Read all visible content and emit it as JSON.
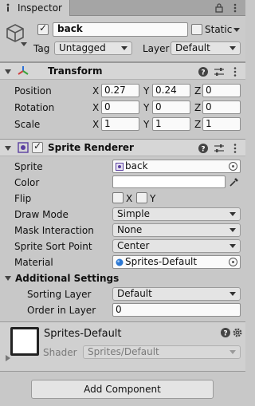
{
  "tab": {
    "label": "Inspector"
  },
  "object": {
    "name": "back",
    "active": true,
    "static_label": "Static",
    "static_checked": false,
    "tag_label": "Tag",
    "tag_value": "Untagged",
    "layer_label": "Layer",
    "layer_value": "Default"
  },
  "transform": {
    "title": "Transform",
    "rows": [
      {
        "label": "Position",
        "x": "0.27",
        "y": "0.24",
        "z": "0"
      },
      {
        "label": "Rotation",
        "x": "0",
        "y": "0",
        "z": "0"
      },
      {
        "label": "Scale",
        "x": "1",
        "y": "1",
        "z": "1"
      }
    ],
    "axis": {
      "x": "X",
      "y": "Y",
      "z": "Z"
    }
  },
  "sprite_renderer": {
    "title": "Sprite Renderer",
    "enabled": true,
    "sprite_label": "Sprite",
    "sprite_value": "back",
    "color_label": "Color",
    "color_value": "#ffffff",
    "flip_label": "Flip",
    "flip_x": "X",
    "flip_y": "Y",
    "draw_mode_label": "Draw Mode",
    "draw_mode_value": "Simple",
    "mask_label": "Mask Interaction",
    "mask_value": "None",
    "sort_point_label": "Sprite Sort Point",
    "sort_point_value": "Center",
    "material_label": "Material",
    "material_value": "Sprites-Default",
    "additional_label": "Additional Settings",
    "sorting_layer_label": "Sorting Layer",
    "sorting_layer_value": "Default",
    "order_label": "Order in Layer",
    "order_value": "0"
  },
  "material": {
    "name": "Sprites-Default",
    "shader_label": "Shader",
    "shader_value": "Sprites/Default"
  },
  "add_component_label": "Add Component",
  "icons": [
    "inspector-icon",
    "lock-icon",
    "menu-icon",
    "gameobject-cube-icon",
    "transform-icon",
    "sprite-renderer-icon",
    "help-icon",
    "preset-icon",
    "more-icon",
    "eyedropper-icon",
    "object-picker-icon",
    "sprite-icon",
    "material-icon",
    "gear-icon"
  ]
}
